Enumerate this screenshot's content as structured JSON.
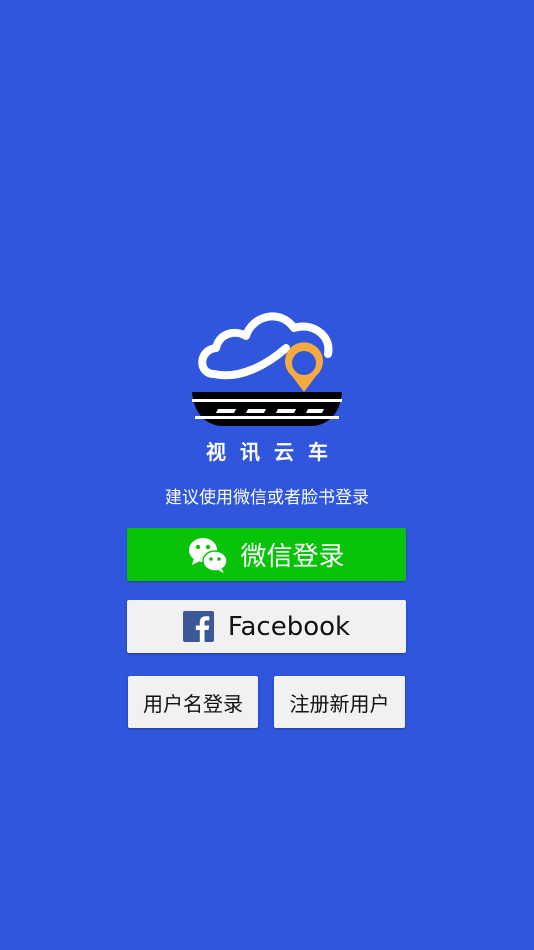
{
  "app": {
    "name": "视讯云车"
  },
  "login": {
    "hint": "建议使用微信或者脸书登录",
    "wechat_label": "微信登录",
    "facebook_label": "Facebook",
    "username_label": "用户名登录",
    "register_label": "注册新用户"
  },
  "icons": {
    "logo": "cloud-road-location-logo",
    "wechat": "wechat-icon",
    "facebook": "facebook-icon"
  },
  "colors": {
    "background": "#2f56dd",
    "wechat_green": "#09c20a",
    "facebook_blue": "#3b5998",
    "pin_orange": "#f5a941",
    "light_button": "#f1f1f1"
  }
}
